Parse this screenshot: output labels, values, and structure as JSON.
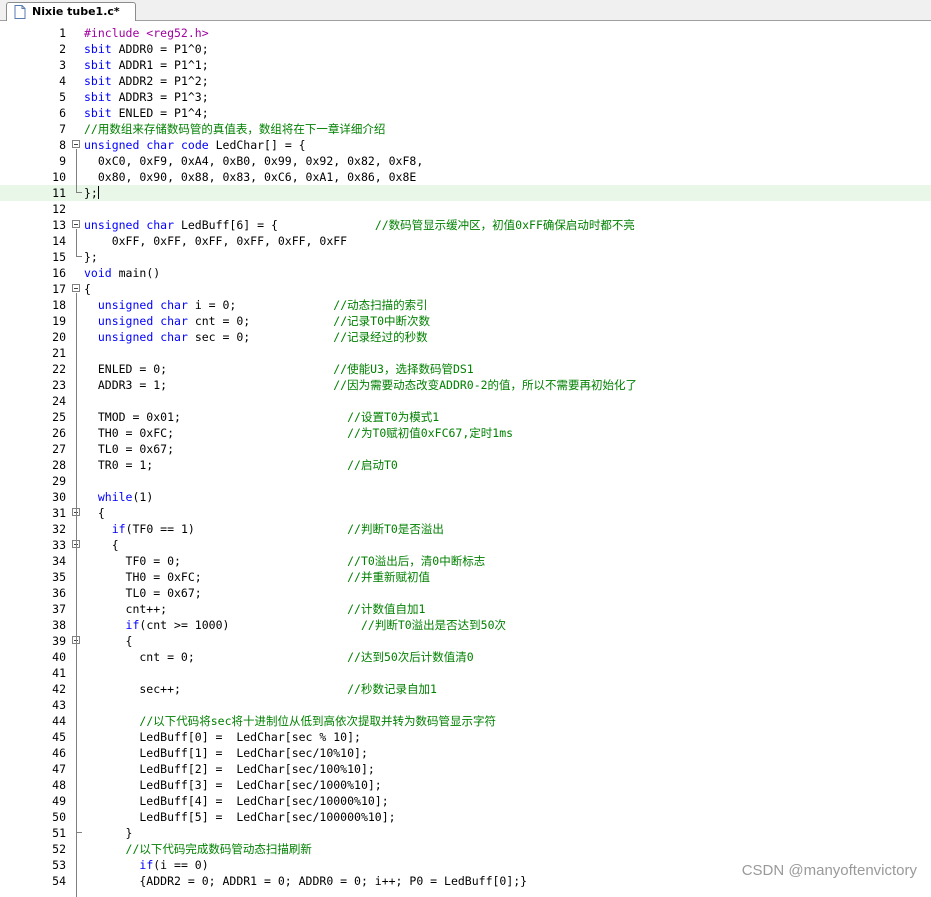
{
  "tab": {
    "title": "Nixie tube1.c*"
  },
  "lines": [
    {
      "n": "1",
      "code": "#include <reg52.h>"
    },
    {
      "n": "2",
      "code": "sbit ADDR0 = P1^0;"
    },
    {
      "n": "3",
      "code": "sbit ADDR1 = P1^1;"
    },
    {
      "n": "4",
      "code": "sbit ADDR2 = P1^2;"
    },
    {
      "n": "5",
      "code": "sbit ADDR3 = P1^3;"
    },
    {
      "n": "6",
      "code": "sbit ENLED = P1^4;"
    },
    {
      "n": "7",
      "code": "//用数组来存储数码管的真值表，数组将在下一章详细介绍"
    },
    {
      "n": "8",
      "code": "unsigned char code LedChar[] = {"
    },
    {
      "n": "9",
      "code": "  0xC0, 0xF9, 0xA4, 0xB0, 0x99, 0x92, 0x82, 0xF8,"
    },
    {
      "n": "10",
      "code": "  0x80, 0x90, 0x88, 0x83, 0xC6, 0xA1, 0x86, 0x8E"
    },
    {
      "n": "11",
      "code": "};"
    },
    {
      "n": "12",
      "code": ""
    },
    {
      "n": "13",
      "code": "unsigned char LedBuff[6] = {              //数码管显示缓冲区，初值0xFF确保启动时都不亮"
    },
    {
      "n": "14",
      "code": "    0xFF, 0xFF, 0xFF, 0xFF, 0xFF, 0xFF"
    },
    {
      "n": "15",
      "code": "};"
    },
    {
      "n": "16",
      "code": "void main()"
    },
    {
      "n": "17",
      "code": "{"
    },
    {
      "n": "18",
      "code": "  unsigned char i = 0;              //动态扫描的索引"
    },
    {
      "n": "19",
      "code": "  unsigned char cnt = 0;            //记录T0中断次数"
    },
    {
      "n": "20",
      "code": "  unsigned char sec = 0;            //记录经过的秒数"
    },
    {
      "n": "21",
      "code": ""
    },
    {
      "n": "22",
      "code": "  ENLED = 0;                        //使能U3，选择数码管DS1"
    },
    {
      "n": "23",
      "code": "  ADDR3 = 1;                        //因为需要动态改变ADDR0-2的值，所以不需要再初始化了"
    },
    {
      "n": "24",
      "code": ""
    },
    {
      "n": "25",
      "code": "  TMOD = 0x01;                        //设置T0为模式1"
    },
    {
      "n": "26",
      "code": "  TH0 = 0xFC;                         //为T0赋初值0xFC67,定时1ms"
    },
    {
      "n": "27",
      "code": "  TL0 = 0x67;"
    },
    {
      "n": "28",
      "code": "  TR0 = 1;                            //启动T0"
    },
    {
      "n": "29",
      "code": ""
    },
    {
      "n": "30",
      "code": "  while(1)"
    },
    {
      "n": "31",
      "code": "  {"
    },
    {
      "n": "32",
      "code": "    if(TF0 == 1)                      //判断T0是否溢出"
    },
    {
      "n": "33",
      "code": "    {"
    },
    {
      "n": "34",
      "code": "      TF0 = 0;                        //T0溢出后，清0中断标志"
    },
    {
      "n": "35",
      "code": "      TH0 = 0xFC;                     //并重新赋初值"
    },
    {
      "n": "36",
      "code": "      TL0 = 0x67;"
    },
    {
      "n": "37",
      "code": "      cnt++;                          //计数值自加1"
    },
    {
      "n": "38",
      "code": "      if(cnt >= 1000)                   //判断T0溢出是否达到50次"
    },
    {
      "n": "39",
      "code": "      {"
    },
    {
      "n": "40",
      "code": "        cnt = 0;                      //达到50次后计数值清0"
    },
    {
      "n": "41",
      "code": ""
    },
    {
      "n": "42",
      "code": "        sec++;                        //秒数记录自加1"
    },
    {
      "n": "43",
      "code": ""
    },
    {
      "n": "44",
      "code": "        //以下代码将sec将十进制位从低到高依次提取并转为数码管显示字符"
    },
    {
      "n": "45",
      "code": "        LedBuff[0] =  LedChar[sec % 10];"
    },
    {
      "n": "46",
      "code": "        LedBuff[1] =  LedChar[sec/10%10];"
    },
    {
      "n": "47",
      "code": "        LedBuff[2] =  LedChar[sec/100%10];"
    },
    {
      "n": "48",
      "code": "        LedBuff[3] =  LedChar[sec/1000%10];"
    },
    {
      "n": "49",
      "code": "        LedBuff[4] =  LedChar[sec/10000%10];"
    },
    {
      "n": "50",
      "code": "        LedBuff[5] =  LedChar[sec/100000%10];"
    },
    {
      "n": "51",
      "code": "      }"
    },
    {
      "n": "52",
      "code": "      //以下代码完成数码管动态扫描刷新"
    },
    {
      "n": "53",
      "code": "        if(i == 0)"
    },
    {
      "n": "54",
      "code": "        {ADDR2 = 0; ADDR1 = 0; ADDR0 = 0; i++; P0 = LedBuff[0];}"
    }
  ],
  "watermark": "CSDN @manyoftenvictory",
  "icons": {
    "tab": "file-icon",
    "fold": "fold-minus-icon"
  },
  "colors": {
    "keyword": "#0000ff",
    "preprocessor": "#a000a0",
    "comment": "#008000",
    "current_line": "#e8f7e8"
  }
}
